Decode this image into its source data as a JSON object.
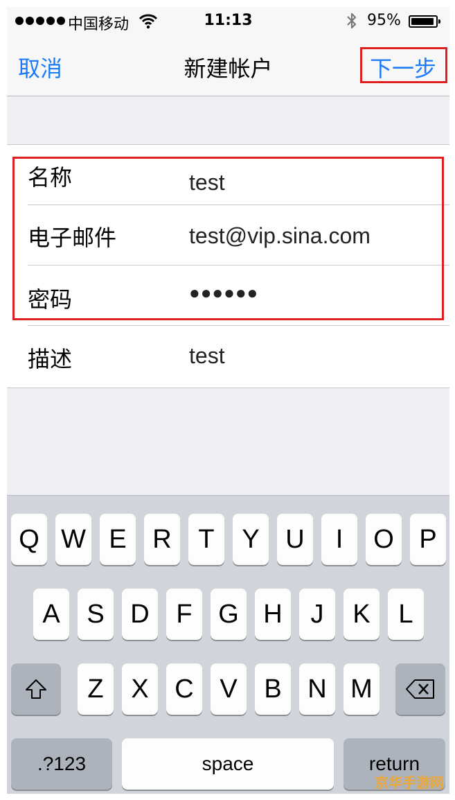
{
  "status_bar": {
    "carrier": "中国移动",
    "time": "11:13",
    "battery_percent_label": "95%",
    "battery_level": 0.95,
    "signal_bars": 5,
    "icons": [
      "signal-dots-icon",
      "wifi-icon",
      "bluetooth-icon",
      "battery-icon"
    ]
  },
  "nav": {
    "cancel_label": "取消",
    "title": "新建帐户",
    "next_label": "下一步"
  },
  "form": {
    "rows": [
      {
        "label": "名称",
        "value": "test"
      },
      {
        "label": "电子邮件",
        "value": "test@vip.sina.com"
      },
      {
        "label": "密码",
        "value": "●●●●●●"
      },
      {
        "label": "描述",
        "value": "test"
      }
    ]
  },
  "keyboard": {
    "row1": [
      "Q",
      "W",
      "E",
      "R",
      "T",
      "Y",
      "U",
      "I",
      "O",
      "P"
    ],
    "row2": [
      "A",
      "S",
      "D",
      "F",
      "G",
      "H",
      "J",
      "K",
      "L"
    ],
    "row3": [
      "Z",
      "X",
      "C",
      "V",
      "B",
      "N",
      "M"
    ],
    "numbers_label": ".?123",
    "space_label": "space",
    "return_label": "return",
    "icons": [
      "shift-icon",
      "delete-icon"
    ]
  },
  "watermark": "京华手游网",
  "colors": {
    "accent": "#1c7bf5",
    "highlight": "#e02020"
  }
}
